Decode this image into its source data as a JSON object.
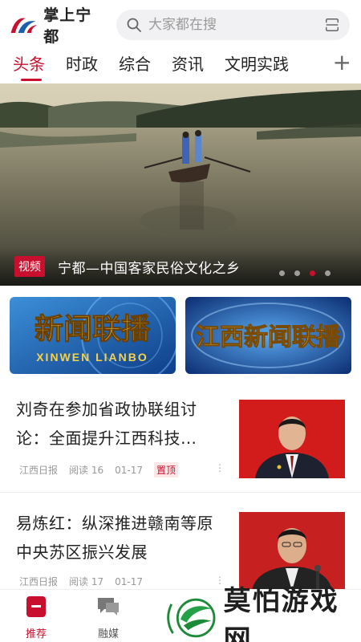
{
  "app": {
    "name": "掌上宁都",
    "brand_color": "#c8102e",
    "logo_icon": "ningdu-logo-icon"
  },
  "search": {
    "placeholder": "大家都在搜",
    "icon": "search-icon",
    "scan_icon": "scan-icon"
  },
  "tabs": [
    {
      "label": "头条",
      "active": true
    },
    {
      "label": "时政",
      "active": false
    },
    {
      "label": "综合",
      "active": false
    },
    {
      "label": "资讯",
      "active": false
    },
    {
      "label": "文明实践",
      "active": false
    }
  ],
  "tab_add_label": "+",
  "banner": {
    "tag": "视频",
    "caption": "宁都—中国客家民俗文化之乡",
    "slide_count": 4,
    "active_slide": 3
  },
  "programs": [
    {
      "title": "新闻联播",
      "subtitle": "XINWEN LIANBO"
    },
    {
      "title": "江西新闻联播"
    }
  ],
  "news": [
    {
      "title": "刘奇在参加省政协联组讨论：全面提升江西科技…",
      "source": "江西日报",
      "reads_label": "阅读",
      "reads": "16",
      "date": "01-17",
      "pinned_label": "置顶",
      "more": "⋮"
    },
    {
      "title": "易炼红：纵深推进赣南等原中央苏区振兴发展",
      "source": "江西日报",
      "reads_label": "阅读",
      "reads": "17",
      "date": "01-17",
      "more": "⋮"
    }
  ],
  "bottom_nav": [
    {
      "label": "推荐",
      "icon": "recommend-icon",
      "active": true
    },
    {
      "label": "融媒",
      "icon": "media-chat-icon",
      "active": false
    }
  ],
  "watermark": {
    "text": "莫怕游戏网",
    "logo_icon": "watermark-logo-icon"
  }
}
